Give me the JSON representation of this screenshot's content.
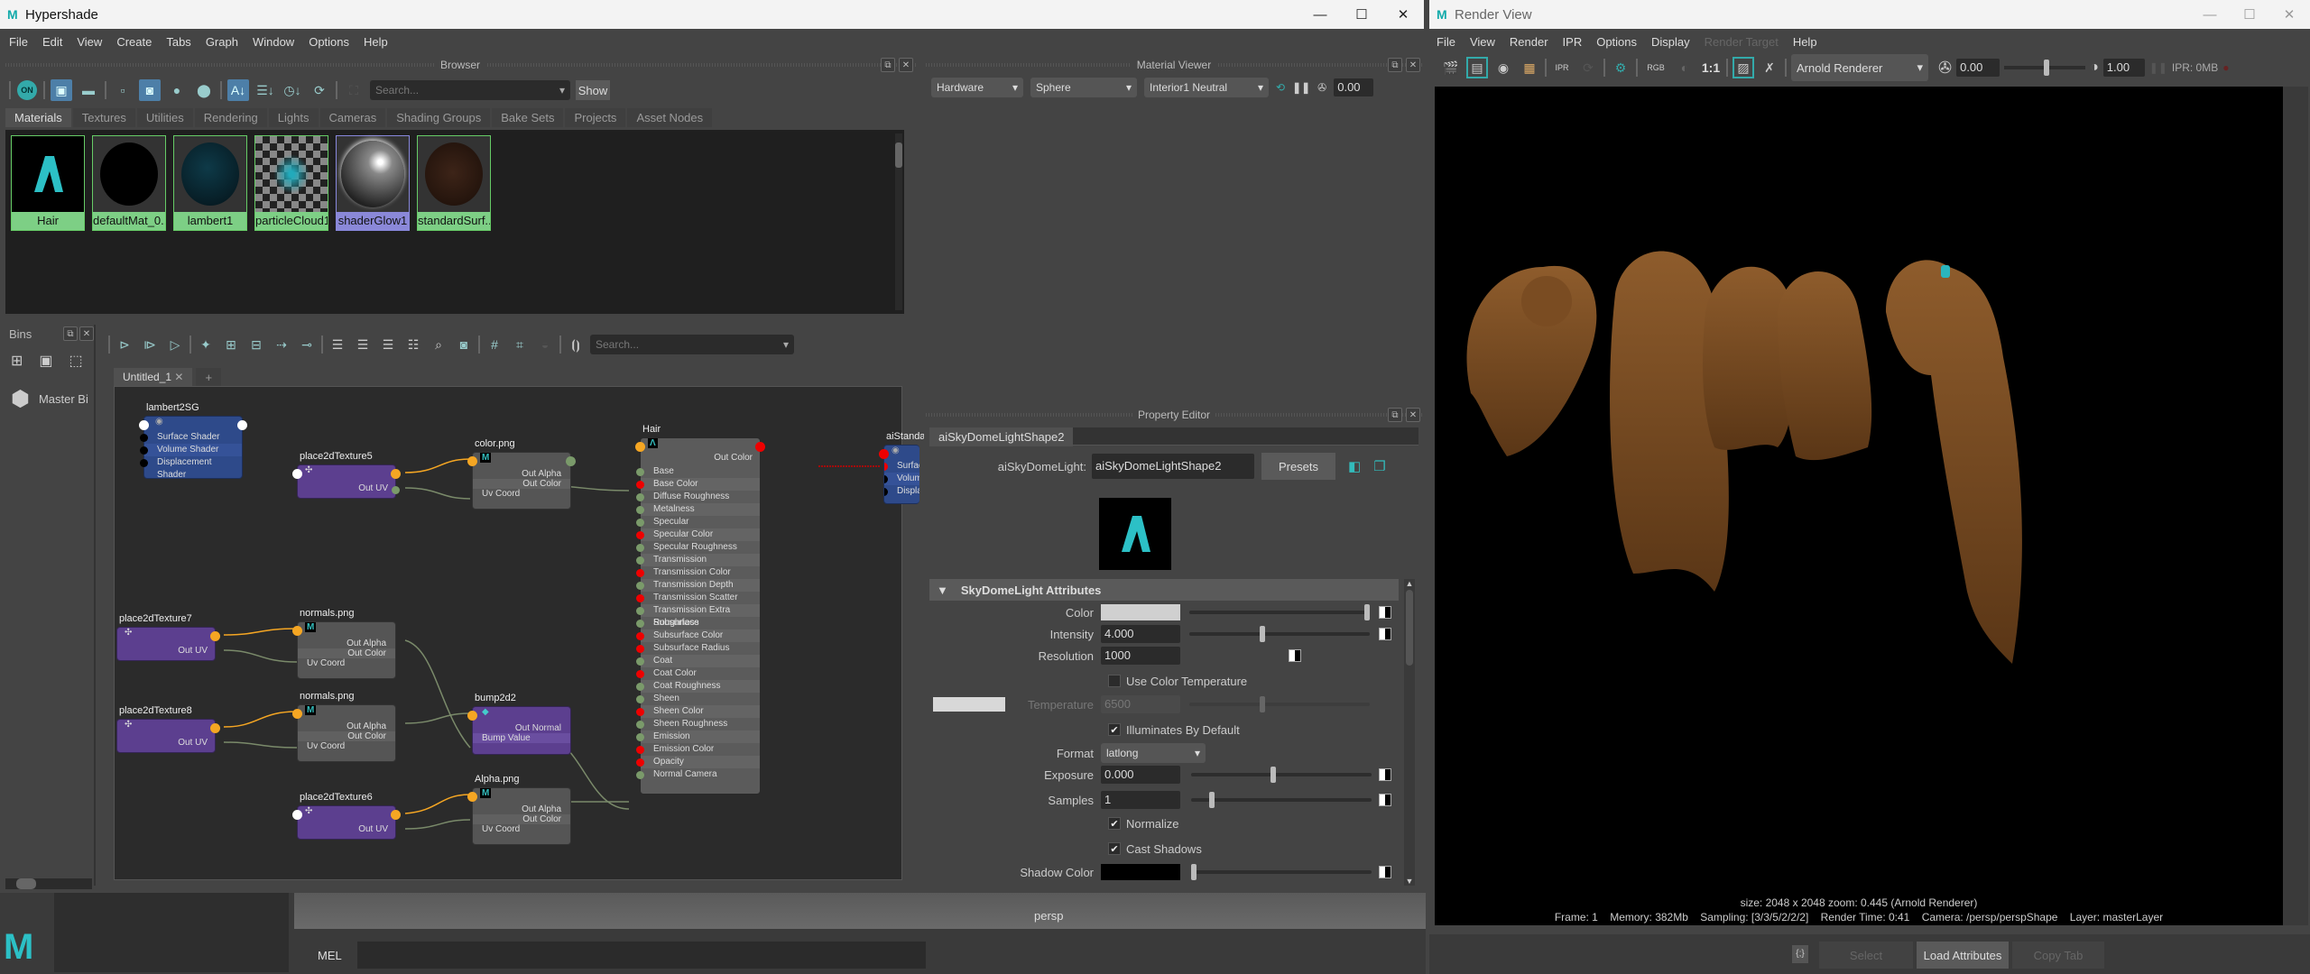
{
  "hypershade": {
    "title": "Hypershade",
    "menu": [
      "File",
      "Edit",
      "View",
      "Create",
      "Tabs",
      "Graph",
      "Window",
      "Options",
      "Help"
    ],
    "browser": {
      "header": "Browser",
      "search_placeholder": "Search...",
      "show_label": "Show",
      "tabs": [
        "Materials",
        "Textures",
        "Utilities",
        "Rendering",
        "Lights",
        "Cameras",
        "Shading Groups",
        "Bake Sets",
        "Projects",
        "Asset Nodes"
      ],
      "active_tab": "Materials",
      "materials": [
        {
          "name": "Hair",
          "preview": "arnold-logo"
        },
        {
          "name": "defaultMat_0...",
          "preview": "black-sphere"
        },
        {
          "name": "lambert1",
          "preview": "dark-teal-sphere"
        },
        {
          "name": "particleCloud1",
          "preview": "checker-cloud"
        },
        {
          "name": "shaderGlow1",
          "preview": "glow-sphere",
          "selected": true
        },
        {
          "name": "standardSurf...",
          "preview": "brown-sphere"
        }
      ]
    },
    "bins": {
      "header": "Bins",
      "master_bin": "Master Bi"
    },
    "graph": {
      "search_placeholder": "Search...",
      "tabs": [
        "Untitled_1",
        "+"
      ],
      "nodes": {
        "lambert2SG": {
          "title": "lambert2SG",
          "ports": [
            "Surface Shader",
            "Volume Shader",
            "Displacement Shader"
          ]
        },
        "place2dTexture5": {
          "title": "place2dTexture5",
          "out": "Out UV"
        },
        "colorPng": {
          "title": "color.png",
          "outs": [
            "Out Alpha",
            "Out Color"
          ],
          "in": "Uv Coord"
        },
        "place2dTexture7": {
          "title": "place2dTexture7",
          "out": "Out UV"
        },
        "normalsPng1": {
          "title": "normals.png",
          "outs": [
            "Out Alpha",
            "Out Color"
          ],
          "in": "Uv Coord"
        },
        "place2dTexture8": {
          "title": "place2dTexture8",
          "out": "Out UV"
        },
        "normalsPng2": {
          "title": "normals.png",
          "outs": [
            "Out Alpha",
            "Out Color"
          ],
          "in": "Uv Coord"
        },
        "bump2d2": {
          "title": "bump2d2",
          "out": "Out Normal",
          "in": "Bump Value"
        },
        "place2dTexture6": {
          "title": "place2dTexture6",
          "out": "Out UV"
        },
        "alphaPng": {
          "title": "Alpha.png",
          "outs": [
            "Out Alpha",
            "Out Color"
          ],
          "in": "Uv Coord"
        },
        "hair": {
          "title": "Hair",
          "out": "Out Color",
          "attrs": [
            "Base",
            "Base Color",
            "Diffuse Roughness",
            "Metalness",
            "Specular",
            "Specular Color",
            "Specular Roughness",
            "Transmission",
            "Transmission Color",
            "Transmission Depth",
            "Transmission Scatter",
            "Transmission Extra Roughness",
            "Subsurface",
            "Subsurface Color",
            "Subsurface Radius",
            "Coat",
            "Coat Color",
            "Coat Roughness",
            "Sheen",
            "Sheen Color",
            "Sheen Roughness",
            "Emission",
            "Emission Color",
            "Opacity",
            "Normal Camera"
          ]
        },
        "aiStandardSurfaceSG": {
          "title": "aiStandardSurfac",
          "ports": [
            "Surface Shader",
            "Volume Shader",
            "Displacement Sl"
          ]
        }
      }
    },
    "material_viewer": {
      "header": "Material Viewer",
      "renderer": "Hardware",
      "geometry": "Sphere",
      "environment": "Interior1 Neutral",
      "exposure": "0.00"
    },
    "property_editor": {
      "header": "Property Editor",
      "tab": "aiSkyDomeLightShape2",
      "node_label": "aiSkyDomeLight:",
      "node_name": "aiSkyDomeLightShape2",
      "presets_label": "Presets",
      "section": "SkyDomeLight Attributes",
      "color_label": "Color",
      "intensity_label": "Intensity",
      "intensity": "4.000",
      "resolution_label": "Resolution",
      "resolution": "1000",
      "use_color_temp_label": "Use Color Temperature",
      "use_color_temp": false,
      "temperature_label": "Temperature",
      "temperature": "6500",
      "illuminates_label": "Illuminates By Default",
      "illuminates": true,
      "format_label": "Format",
      "format": "latlong",
      "exposure_label": "Exposure",
      "exposure": "0.000",
      "samples_label": "Samples",
      "samples": "1",
      "normalize_label": "Normalize",
      "normalize": true,
      "cast_shadows_label": "Cast Shadows",
      "cast_shadows": true,
      "shadow_color_label": "Shadow Color"
    },
    "bottom": {
      "mel_label": "MEL",
      "viewport_label": "persp"
    }
  },
  "render_view": {
    "title": "Render View",
    "menu": [
      "File",
      "View",
      "Render",
      "IPR",
      "Options",
      "Display",
      "Render Target",
      "Help"
    ],
    "disabled_menu": [
      "Render Target"
    ],
    "renderer": "Arnold Renderer",
    "exposure": "0.00",
    "gamma": "1.00",
    "ipr_memory": "IPR: 0MB",
    "ratio_label": "1:1",
    "rgb_label": "RGB",
    "info_line1": "size: 2048 x 2048 zoom: 0.445    (Arnold Renderer)",
    "info_line2": "Frame: 1    Memory: 382Mb    Sampling: [3/3/5/2/2/2]    Render Time: 0:41    Camera: /persp/perspShape    Layer: masterLayer",
    "buttons": [
      "Select",
      "Load Attributes",
      "Copy Tab"
    ]
  },
  "colors": {
    "accent": "#3fb8c3",
    "material_label": "#7dcf85",
    "selected_label": "#8a88d8",
    "hair": "#8a5a2b"
  }
}
